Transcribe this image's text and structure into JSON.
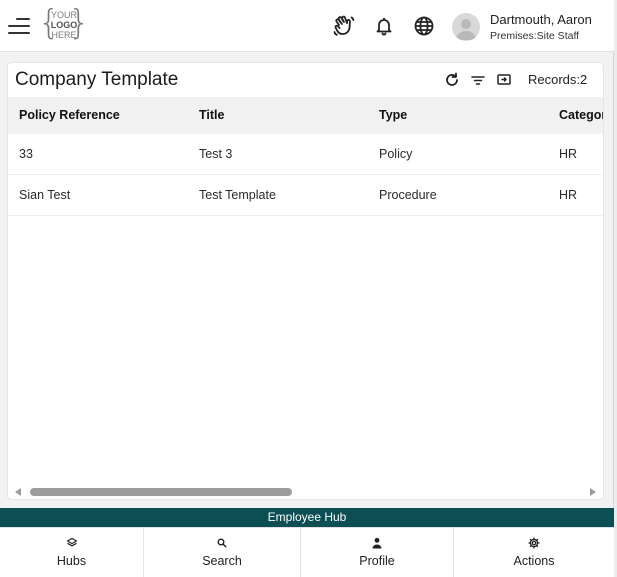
{
  "header": {
    "logo": {
      "line1": "YOUR",
      "line2": "LOGO",
      "line3": "HERE"
    },
    "user": {
      "name": "Dartmouth, Aaron",
      "role": "Premises:Site Staff"
    }
  },
  "panel": {
    "title": "Company Template",
    "records_label": "Records:2",
    "columns": [
      "Policy Reference",
      "Title",
      "Type",
      "Category"
    ],
    "rows": [
      [
        "33",
        "Test 3",
        "Policy",
        "HR"
      ],
      [
        "Sian Test",
        "Test Template",
        "Procedure",
        "HR"
      ]
    ]
  },
  "hub_bar": {
    "label": "Employee Hub"
  },
  "bottom_nav": {
    "items": [
      {
        "label": "Hubs",
        "icon": "layers-icon"
      },
      {
        "label": "Search",
        "icon": "search-icon"
      },
      {
        "label": "Profile",
        "icon": "person-icon"
      },
      {
        "label": "Actions",
        "icon": "gear-icon"
      }
    ]
  },
  "colors": {
    "accent": "#0b4f55",
    "header_row": "#f1f1f1",
    "scroll_thumb": "#9c9c9c"
  }
}
